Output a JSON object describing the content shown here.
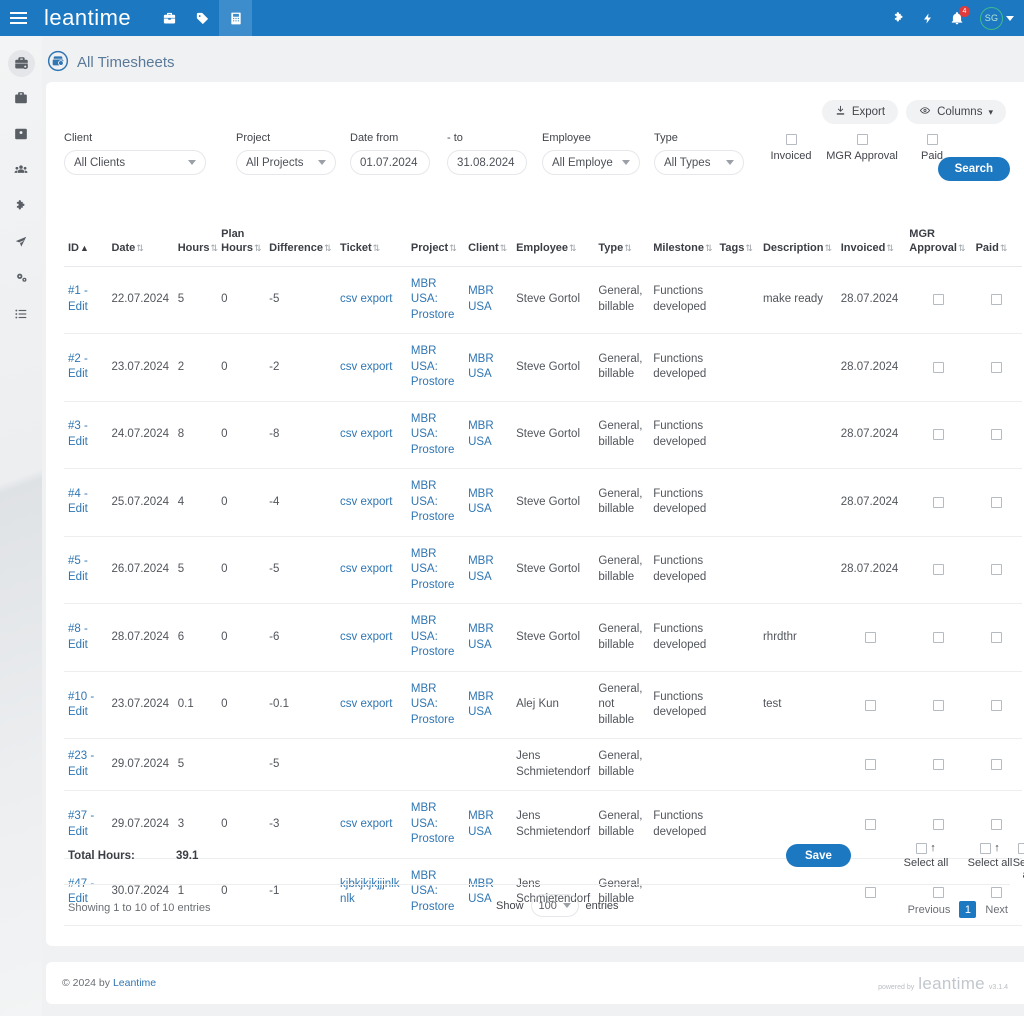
{
  "topbar": {
    "brand": "leantime",
    "icons": [
      "toolbox-icon",
      "tag-icon",
      "timesheet-icon"
    ],
    "right_icons": [
      "puzzle-icon",
      "bolt-icon",
      "bell-icon"
    ],
    "notification_count": "4",
    "avatar_initials": "SG",
    "accent": "#1c78c0"
  },
  "sidebar": {
    "items": [
      {
        "name": "sidebar-item-timesheets",
        "icon": "briefcase-gear-icon",
        "active": true
      },
      {
        "name": "sidebar-item-projects",
        "icon": "briefcase-icon",
        "active": false
      },
      {
        "name": "sidebar-item-clients",
        "icon": "id-card-icon",
        "active": false
      },
      {
        "name": "sidebar-item-users",
        "icon": "users-icon",
        "active": false
      },
      {
        "name": "sidebar-item-plugins",
        "icon": "puzzle-icon",
        "active": false
      },
      {
        "name": "sidebar-item-integrations",
        "icon": "share-nodes-icon",
        "active": false
      },
      {
        "name": "sidebar-item-settings",
        "icon": "gears-icon",
        "active": false
      },
      {
        "name": "sidebar-item-lists",
        "icon": "list-icon",
        "active": false
      }
    ]
  },
  "page": {
    "title": "All Timesheets",
    "title_icon": "timesheet-circle-icon"
  },
  "toolbar": {
    "export_label": "Export",
    "export_icon": "download-icon",
    "columns_label": "Columns",
    "columns_icon": "columns-icon",
    "columns_caret": "▾"
  },
  "filters": {
    "client": {
      "label": "Client",
      "value": "All Clients"
    },
    "project": {
      "label": "Project",
      "value": "All Projects"
    },
    "date_from": {
      "label": "Date from",
      "value": "01.07.2024"
    },
    "date_to": {
      "label": "- to",
      "value": "31.08.2024"
    },
    "employee": {
      "label": "Employee",
      "value": "All Employe"
    },
    "type": {
      "label": "Type",
      "value": "All Types"
    },
    "invoiced": {
      "label": "Invoiced",
      "checked": false
    },
    "mgr_approval": {
      "label": "MGR Approval",
      "checked": false
    },
    "paid": {
      "label": "Paid",
      "checked": false
    },
    "search_label": "Search"
  },
  "table": {
    "columns": [
      {
        "label": "ID",
        "sort": "asc"
      },
      {
        "label": "Date",
        "sort": "none"
      },
      {
        "label": "Hours",
        "sort": "none"
      },
      {
        "label": "Plan Hours",
        "sort": "none"
      },
      {
        "label": "Difference",
        "sort": "none"
      },
      {
        "label": "Ticket",
        "sort": "none"
      },
      {
        "label": "Project",
        "sort": "none"
      },
      {
        "label": "Client",
        "sort": "none"
      },
      {
        "label": "Employee",
        "sort": "none"
      },
      {
        "label": "Type",
        "sort": "none"
      },
      {
        "label": "Milestone",
        "sort": "none"
      },
      {
        "label": "Tags",
        "sort": "none"
      },
      {
        "label": "Description",
        "sort": "none"
      },
      {
        "label": "Invoiced",
        "sort": "none"
      },
      {
        "label": "MGR Approval",
        "sort": "none"
      },
      {
        "label": "Paid",
        "sort": "none"
      }
    ],
    "rows": [
      {
        "id": "#1 - Edit",
        "date": "22.07.2024",
        "hours": "5",
        "plan_hours": "0",
        "difference": "-5",
        "ticket": "csv export",
        "project": "MBR USA: Prostore",
        "client": "MBR USA",
        "employee": "Steve Gortol",
        "type": "General, billable",
        "milestone": "Functions developed",
        "tags": "",
        "description": "make ready",
        "invoiced": "28.07.2024",
        "mgr_approval": false,
        "paid": false
      },
      {
        "id": "#2 - Edit",
        "date": "23.07.2024",
        "hours": "2",
        "plan_hours": "0",
        "difference": "-2",
        "ticket": "csv export",
        "project": "MBR USA: Prostore",
        "client": "MBR USA",
        "employee": "Steve Gortol",
        "type": "General, billable",
        "milestone": "Functions developed",
        "tags": "",
        "description": "",
        "invoiced": "28.07.2024",
        "mgr_approval": false,
        "paid": false
      },
      {
        "id": "#3 - Edit",
        "date": "24.07.2024",
        "hours": "8",
        "plan_hours": "0",
        "difference": "-8",
        "ticket": "csv export",
        "project": "MBR USA: Prostore",
        "client": "MBR USA",
        "employee": "Steve Gortol",
        "type": "General, billable",
        "milestone": "Functions developed",
        "tags": "",
        "description": "",
        "invoiced": "28.07.2024",
        "mgr_approval": false,
        "paid": false
      },
      {
        "id": "#4 - Edit",
        "date": "25.07.2024",
        "hours": "4",
        "plan_hours": "0",
        "difference": "-4",
        "ticket": "csv export",
        "project": "MBR USA: Prostore",
        "client": "MBR USA",
        "employee": "Steve Gortol",
        "type": "General, billable",
        "milestone": "Functions developed",
        "tags": "",
        "description": "",
        "invoiced": "28.07.2024",
        "mgr_approval": false,
        "paid": false
      },
      {
        "id": "#5 - Edit",
        "date": "26.07.2024",
        "hours": "5",
        "plan_hours": "0",
        "difference": "-5",
        "ticket": "csv export",
        "project": "MBR USA: Prostore",
        "client": "MBR USA",
        "employee": "Steve Gortol",
        "type": "General, billable",
        "milestone": "Functions developed",
        "tags": "",
        "description": "",
        "invoiced": "28.07.2024",
        "mgr_approval": false,
        "paid": false
      },
      {
        "id": "#8 - Edit",
        "date": "28.07.2024",
        "hours": "6",
        "plan_hours": "0",
        "difference": "-6",
        "ticket": "csv export",
        "project": "MBR USA: Prostore",
        "client": "MBR USA",
        "employee": "Steve Gortol",
        "type": "General, billable",
        "milestone": "Functions developed",
        "tags": "",
        "description": "rhrdthr",
        "invoiced": "",
        "invoiced_checkbox": true,
        "mgr_approval": false,
        "paid": false
      },
      {
        "id": "#10 - Edit",
        "date": "23.07.2024",
        "hours": "0.1",
        "plan_hours": "0",
        "difference": "-0.1",
        "ticket": "csv export",
        "project": "MBR USA: Prostore",
        "client": "MBR USA",
        "employee": "Alej Kun",
        "type": "General, not billable",
        "milestone": "Functions developed",
        "tags": "",
        "description": "test",
        "invoiced": "",
        "invoiced_checkbox": true,
        "mgr_approval": false,
        "paid": false
      },
      {
        "id": "#23 - Edit",
        "date": "29.07.2024",
        "hours": "5",
        "plan_hours": "",
        "difference": "-5",
        "ticket": "",
        "project": "",
        "client": "",
        "employee": "Jens Schmietendorf",
        "type": "General, billable",
        "milestone": "",
        "tags": "",
        "description": "",
        "invoiced": "",
        "invoiced_checkbox": true,
        "mgr_approval": false,
        "paid": false
      },
      {
        "id": "#37 - Edit",
        "date": "29.07.2024",
        "hours": "3",
        "plan_hours": "0",
        "difference": "-3",
        "ticket": "csv export",
        "project": "MBR USA: Prostore",
        "client": "MBR USA",
        "employee": "Jens Schmietendorf",
        "type": "General, billable",
        "milestone": "Functions developed",
        "tags": "",
        "description": "",
        "invoiced": "",
        "invoiced_checkbox": true,
        "mgr_approval": false,
        "paid": false
      },
      {
        "id": "#47 - Edit",
        "date": "30.07.2024",
        "hours": "1",
        "plan_hours": "0",
        "difference": "-1",
        "ticket": "kjbkjkjkjjjnlknlk",
        "project": "MBR USA: Prostore",
        "client": "MBR USA",
        "employee": "Jens Schmietendorf",
        "type": "General, billable",
        "milestone": "",
        "tags": "",
        "description": "",
        "invoiced": "",
        "invoiced_checkbox": true,
        "mgr_approval": false,
        "paid": false
      }
    ]
  },
  "totals": {
    "label": "Total Hours:",
    "value": "39.1",
    "save_label": "Save",
    "select_all_label": "Select all",
    "select_all_arrow": "↑"
  },
  "bottom": {
    "showing": "Showing 1 to 10 of 10 entries",
    "show_label": "Show",
    "show_value": "100",
    "entries_label": "entries",
    "previous": "Previous",
    "current_page": "1",
    "next": "Next"
  },
  "footer": {
    "copyright": "© 2024 by ",
    "copyright_link": "Leantime",
    "powered_by": "powered by",
    "brand": "leantime",
    "version": "v3.1.4"
  }
}
